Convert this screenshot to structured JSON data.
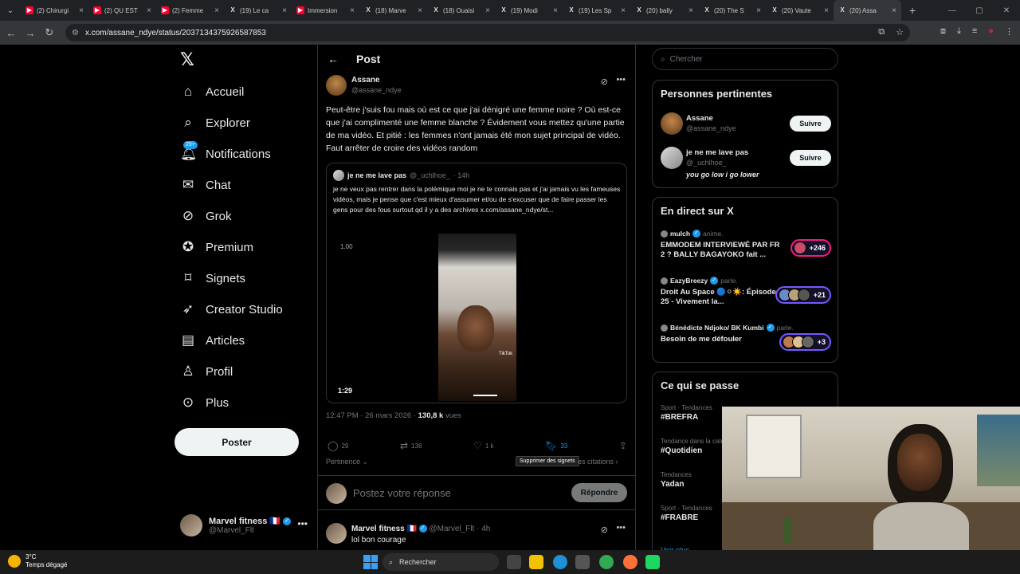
{
  "browser": {
    "tabs": [
      {
        "label": "(2) Chirurgi",
        "type": "yt"
      },
      {
        "label": "(2) QU EST",
        "type": "yt"
      },
      {
        "label": "(2) Femme",
        "type": "yt"
      },
      {
        "label": "(19) Le ca",
        "type": "x"
      },
      {
        "label": "Immersion",
        "type": "yt"
      },
      {
        "label": "(18) Marve",
        "type": "x"
      },
      {
        "label": "(18) Ouaisi",
        "type": "x"
      },
      {
        "label": "(19) Modi",
        "type": "x"
      },
      {
        "label": "(19) Les Sp",
        "type": "x"
      },
      {
        "label": "(20) bally",
        "type": "x"
      },
      {
        "label": "(20) The S",
        "type": "x"
      },
      {
        "label": "(20) Vaute",
        "type": "x"
      },
      {
        "label": "(20) Assa",
        "type": "x",
        "active": true
      }
    ],
    "url": "x.com/assane_ndye/status/2037134375926587853"
  },
  "sidebar": {
    "notifications_badge": "20+",
    "items": [
      {
        "label": "Accueil",
        "icon": "home-icon"
      },
      {
        "label": "Explorer",
        "icon": "search-icon"
      },
      {
        "label": "Notifications",
        "icon": "bell-icon"
      },
      {
        "label": "Chat",
        "icon": "mail-icon"
      },
      {
        "label": "Grok",
        "icon": "grok-icon"
      },
      {
        "label": "Premium",
        "icon": "verified-icon"
      },
      {
        "label": "Signets",
        "icon": "bookmark-icon"
      },
      {
        "label": "Creator Studio",
        "icon": "rocket-icon"
      },
      {
        "label": "Articles",
        "icon": "article-icon"
      },
      {
        "label": "Profil",
        "icon": "person-icon"
      },
      {
        "label": "Plus",
        "icon": "more-circle-icon"
      }
    ],
    "post_button": "Poster",
    "account": {
      "name": "Marvel fitness 🇫🇷",
      "handle": "@Marvel_Flt"
    }
  },
  "main": {
    "header_title": "Post",
    "author": {
      "name": "Assane",
      "handle": "@assane_ndye"
    },
    "text": "Peut-être j'suis fou mais où est ce que j'ai dénigré une femme noire ? Où est-ce que j'ai complimenté une femme blanche ? Évidement vous mettez qu'une partie de ma vidéo. Et pitié : les femmes n'ont jamais été mon sujet principal de vidéo. Faut arrêter de croire des vidéos random",
    "quote": {
      "name": "je ne me lave pas",
      "handle": "@_uchlhoe_",
      "time": "· 14h",
      "text": "je ne veux pas rentrer dans la polémique moi je ne te connais pas et j'ai jamais vu les fameuses vidéos, mais je pense que c'est mieux d'assumer et/ou de s'excuser que de faire passer les gens pour des fous surtout qd il y a des archives  x.com/assane_ndye/st...",
      "video_speed": "1.00",
      "video_duration": "1:29",
      "tiktok_label": "TikTok"
    },
    "meta": {
      "time": "12:47 PM · 26 mars 2026 · ",
      "views": "130,8 k",
      "views_label": " vues"
    },
    "actions": {
      "replies": "29",
      "reposts": "138",
      "likes": "1 k",
      "bookmarks": "33"
    },
    "tooltip": "Supprimer des signets",
    "sort_label": "Pertinence",
    "quotes_label": "es citations",
    "reply_placeholder": "Postez votre réponse",
    "reply_button": "Répondre",
    "first_reply": {
      "name": "Marvel fitness 🇫🇷",
      "handle": "@Marvel_Flt · 4h",
      "text": "lol bon courage"
    }
  },
  "right": {
    "search_placeholder": "Chercher",
    "relevant_title": "Personnes pertinentes",
    "people": [
      {
        "name": "Assane",
        "handle": "@assane_ndye",
        "bio": "",
        "follow": "Suivre"
      },
      {
        "name": "je ne me lave pas",
        "handle": "@_uchlhoe_",
        "bio": "you go low i go lower",
        "follow": "Suivre"
      }
    ],
    "live_title": "En direct sur X",
    "live": [
      {
        "by": "mulch",
        "activity": "anime.",
        "title": "EMMODEM INTERVIEWÉ PAR FR 2 ? BALLY BAGAYOKO fait ...",
        "count": "+246",
        "color": "pink"
      },
      {
        "by": "EazyBreezy",
        "activity": "parle.",
        "title": "Droit Au Space 🔵⚪☀️: Épisode 25 - Vivement la...",
        "count": "+21",
        "color": "purple"
      },
      {
        "by": "Bénédicte Ndjoko/ BK Kumbi",
        "activity": "parle.",
        "title": "Besoin de me défouler",
        "count": "+3",
        "color": "purple"
      }
    ],
    "trends_title": "Ce qui se passe",
    "trends": [
      {
        "category": "Sport · Tendances",
        "name": "#BREFRA"
      },
      {
        "category": "Tendance dans la catégorie",
        "name": "#Quotidien"
      },
      {
        "category": "Tendances",
        "name": "Yadan"
      },
      {
        "category": "Sport · Tendances",
        "name": "#FRABRE"
      }
    ],
    "see_more": "Voir plus"
  },
  "taskbar": {
    "temp": "3°C",
    "weather": "Temps dégagé",
    "search": "Rechercher"
  }
}
